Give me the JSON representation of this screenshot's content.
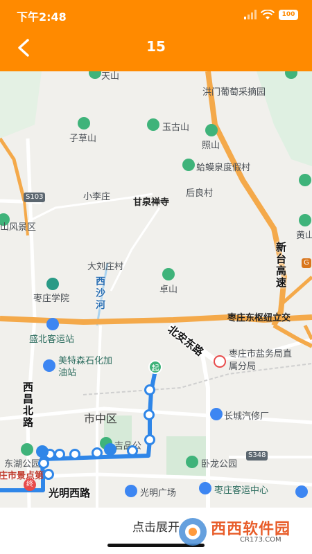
{
  "status_bar": {
    "time": "下午2:48",
    "battery": "100"
  },
  "header": {
    "title": "15",
    "back_icon": "chevron-left-icon",
    "color": "#FF8A00"
  },
  "map": {
    "places": {
      "tianshan": "天山",
      "hongmen": "洪门葡萄采摘园",
      "yugu": "玉古山",
      "zicao": "子草山",
      "zhaoshan": "照山",
      "hama": "蛤蟆泉度假村",
      "xiaoli": "小李庄",
      "ganquan": "甘泉禅寺",
      "houliang": "后良村",
      "fengjing": "山风景区",
      "huangshan": "黄山",
      "daliu": "大刘庄村",
      "zaozhuang_xueyuan": "枣庄学院",
      "zhuoshan": "卓山",
      "hub": "枣庄东枢纽立交",
      "shengbei": "盛北客运站",
      "meite": "美特森石化加油站",
      "yanwu": "枣庄市盐务局直属分局",
      "changcheng": "长城汽修厂",
      "shizhong": "市中区",
      "jipin": "吉品公",
      "donghu": "东湖公园",
      "jingdian": "庄市景点第9",
      "wolong": "卧龙公园",
      "guangming_sq": "光明广场",
      "keyun": "枣庄客运中心"
    },
    "roads": {
      "xinantai": "新台高速",
      "beian": "北安东路",
      "xisha": "西沙河",
      "xichang": "西昌北路",
      "guangming": "光明西路"
    },
    "shields": {
      "s103": "S103",
      "s348": "S348",
      "g": "G"
    },
    "route_markers": {
      "start": "起",
      "end": "终"
    }
  },
  "footer": {
    "expand_label": "点击展开"
  },
  "watermark": {
    "brand": "西西软件园",
    "site": "CR173.COM"
  }
}
